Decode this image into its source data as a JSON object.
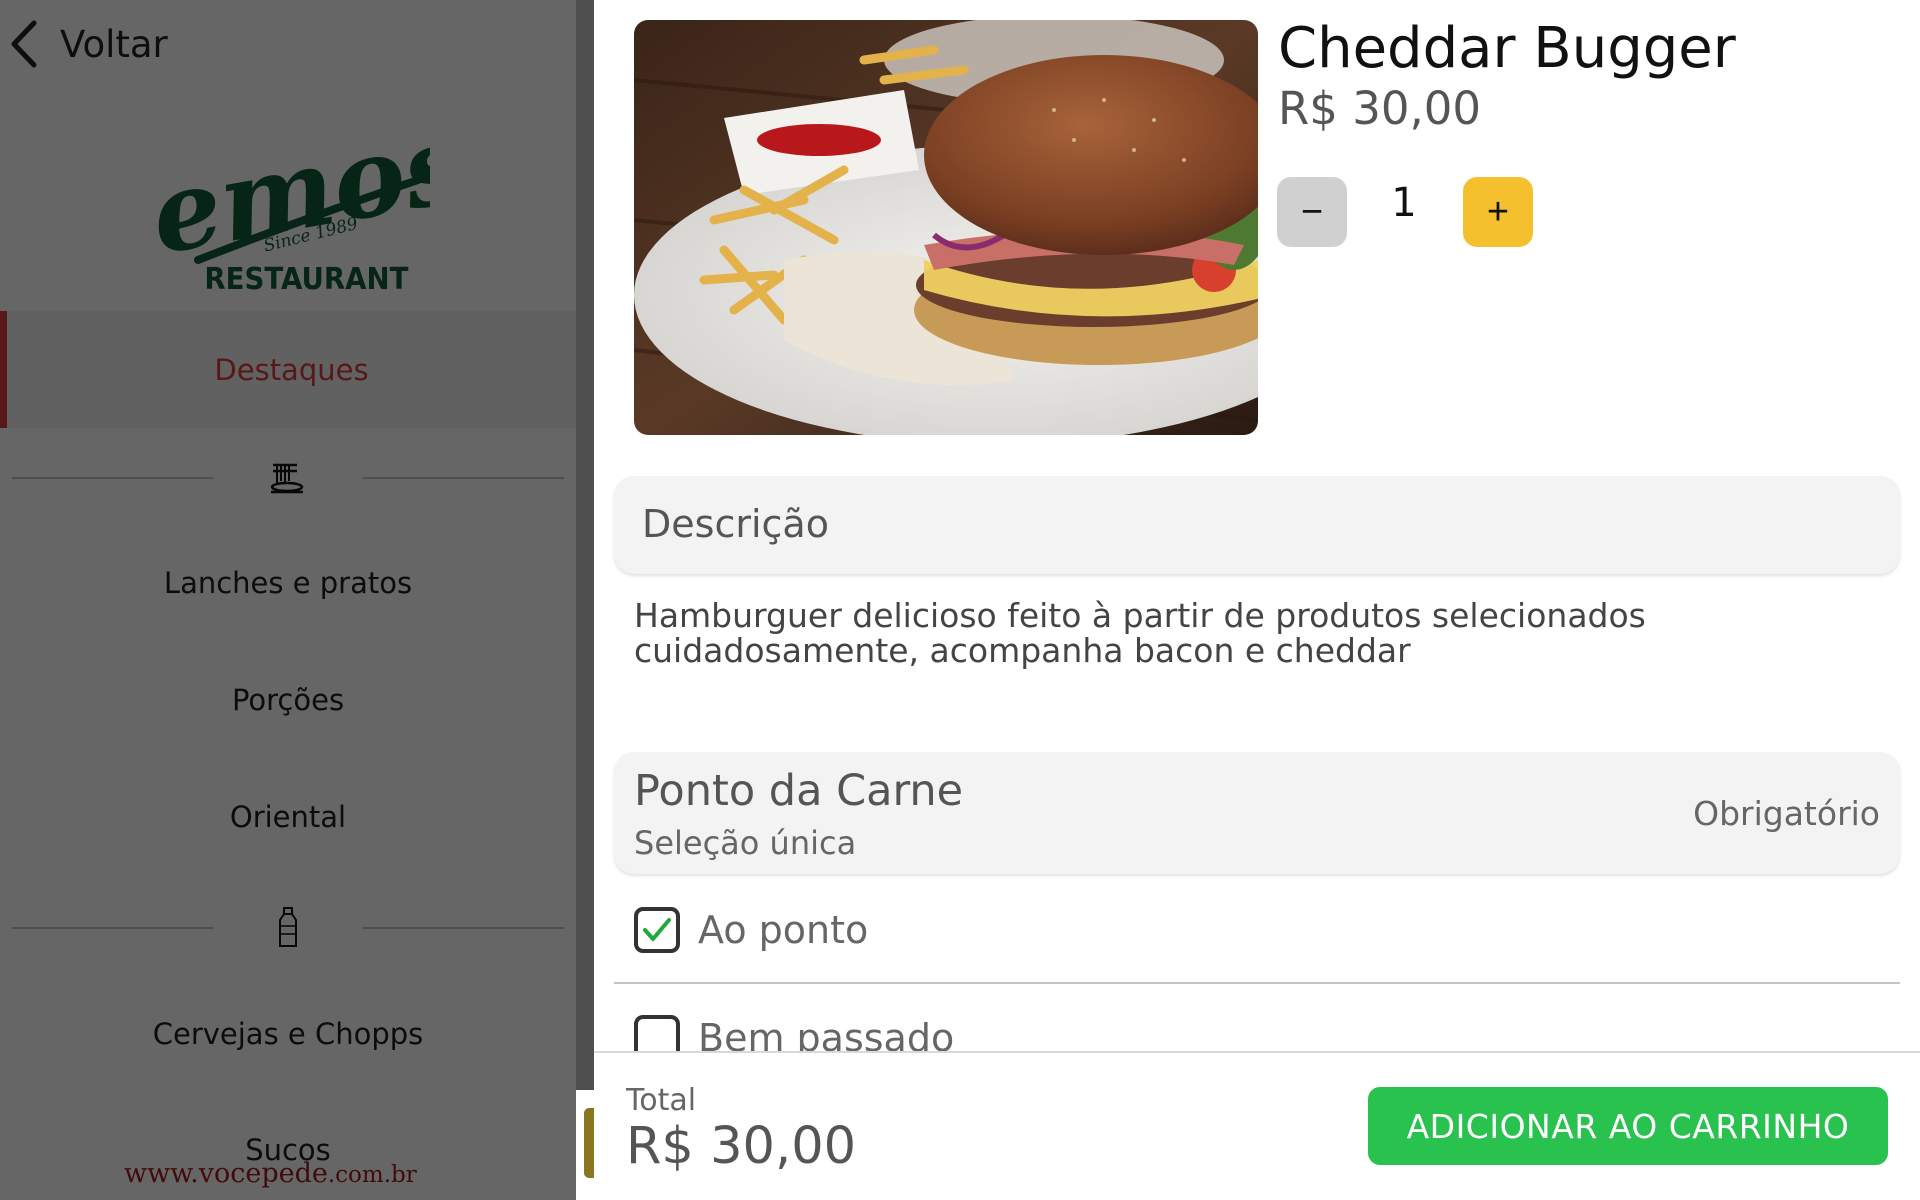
{
  "sidebar": {
    "back_label": "Voltar",
    "logo": {
      "brand": "Demos'",
      "since": "Since 1989",
      "subtitle": "RESTAURANT"
    },
    "active_category": "Destaques",
    "categories": [
      "Lanches e pratos",
      "Porções",
      "Oriental",
      "Cervejas e Chopps",
      "Sucos"
    ],
    "divider_icons": [
      "pasta-plate-icon",
      "bottle-icon"
    ],
    "website": {
      "prefix": "www.",
      "name": "vocepede",
      "suffix": ".com.br"
    }
  },
  "product": {
    "name": "Cheddar Bugger",
    "price": "R$ 30,00",
    "quantity": "1",
    "minus_label": "−",
    "plus_label": "+",
    "image": "burger-photo"
  },
  "description": {
    "title": "Descrição",
    "text": "Hamburguer delicioso feito à partir de produtos selecionados cuidadosamente, acompanha bacon e cheddar"
  },
  "options_group": {
    "title": "Ponto da Carne",
    "subtitle": "Seleção única",
    "required_label": "Obrigatório",
    "options": [
      {
        "label": "Ao ponto",
        "checked": true
      },
      {
        "label": "Bem passado",
        "checked": false
      }
    ]
  },
  "footer": {
    "total_label": "Total",
    "total_value": "R$ 30,00",
    "add_button_label": "ADICIONAR AO CARRINHO"
  },
  "colors": {
    "accent_red": "#d23a3a",
    "add_button_green": "#29c24f",
    "plus_button_yellow": "#f5c02e",
    "logo_green": "#0f5a36"
  }
}
